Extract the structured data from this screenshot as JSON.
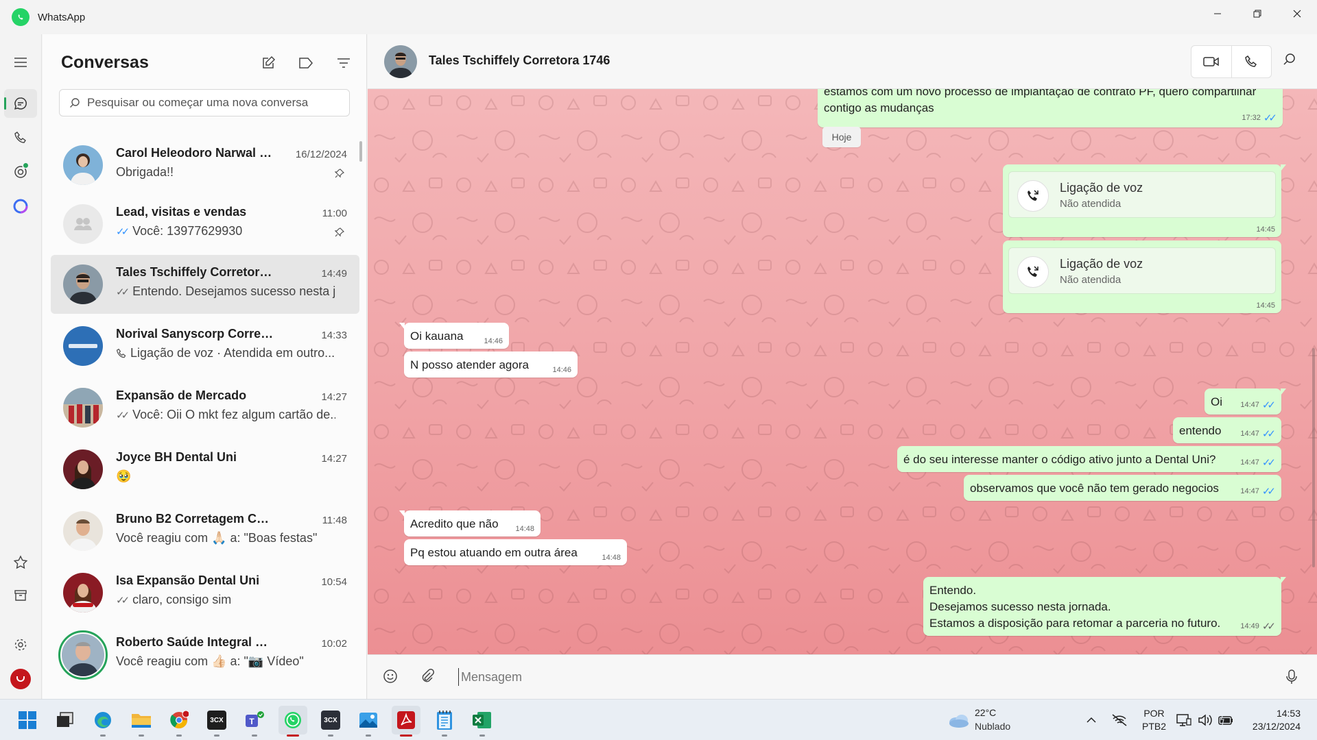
{
  "window": {
    "title": "WhatsApp"
  },
  "colors": {
    "accent": "#25a35a",
    "outgoing_bubble": "#d9fdd3",
    "chat_wallpaper": "#f0a3a6",
    "read_ticks": "#3493ff"
  },
  "sidebar": {
    "title": "Conversas",
    "search_placeholder": "Pesquisar ou começar uma nova conversa",
    "conversations": [
      {
        "name": "Carol Heleodoro Narwal Le...",
        "time": "16/12/2024",
        "preview": "Obrigada!!",
        "pinned": true,
        "ticks": ""
      },
      {
        "name": "Lead, visitas e vendas",
        "time": "11:00",
        "preview": "Você: 13977629930",
        "pinned": true,
        "ticks": "read"
      },
      {
        "name": "Tales Tschiffely Corretora 1746",
        "time": "14:49",
        "preview": "Entendo. Desejamos sucesso nesta j...",
        "pinned": false,
        "ticks": "delivered"
      },
      {
        "name": "Norival Sanyscorp Corretora 1773",
        "time": "14:33",
        "preview": "Ligação de voz · Atendida em outro...",
        "pinned": false,
        "ticks": ""
      },
      {
        "name": "Expansão de Mercado",
        "time": "14:27",
        "preview": "Você: Oii O mkt fez algum cartão de...",
        "pinned": false,
        "ticks": "delivered"
      },
      {
        "name": "Joyce BH Dental Uni",
        "time": "14:27",
        "preview": "🥹",
        "pinned": false,
        "ticks": ""
      },
      {
        "name": "Bruno B2 Corretagem Corretora...",
        "time": "11:48",
        "preview": "Você reagiu com 🙏🏻 a: \"Boas festas\"",
        "pinned": false,
        "ticks": ""
      },
      {
        "name": "Isa Expansão Dental Uni",
        "time": "10:54",
        "preview": "claro, consigo sim",
        "pinned": false,
        "ticks": "delivered"
      },
      {
        "name": "Roberto Saúde Integral Corretor...",
        "time": "10:02",
        "preview": "Você reagiu com 👍🏻 a: \"📷 Vídeo\"",
        "pinned": false,
        "ticks": ""
      }
    ]
  },
  "chat": {
    "contact_name": "Tales Tschiffely Corretora 1746",
    "day_chip": "Hoje",
    "composer_placeholder": "Mensagem",
    "messages": {
      "m0_line1": "estamos com um novo processo de implantação de contrato PF, quero compartilhar",
      "m0_line2": "contigo as mudanças",
      "m0_time": "17:32",
      "call1_title": "Ligação de voz",
      "call1_sub": "Não atendida",
      "call1_time": "14:45",
      "call2_title": "Ligação de voz",
      "call2_sub": "Não atendida",
      "call2_time": "14:45",
      "in1": "Oi kauana",
      "in1_time": "14:46",
      "in2": "N posso atender agora",
      "in2_time": "14:46",
      "out1": "Oi",
      "out1_time": "14:47",
      "out2": "entendo",
      "out2_time": "14:47",
      "out3": "é do seu interesse manter o código ativo junto a Dental Uni?",
      "out3_time": "14:47",
      "out4": "observamos que você não tem gerado negocios",
      "out4_time": "14:47",
      "in3": "Acredito que não",
      "in3_time": "14:48",
      "in4": "Pq estou atuando em outra área",
      "in4_time": "14:48",
      "last_line1": "Entendo.",
      "last_line2": "Desejamos sucesso nesta jornada.",
      "last_line3": "Estamos a disposição para retomar a parceria no futuro.",
      "last_time": "14:49"
    }
  },
  "taskbar": {
    "apps": [
      "start",
      "task-view",
      "edge",
      "file-explorer",
      "chrome",
      "3cx",
      "teams",
      "whatsapp",
      "3cx",
      "photos",
      "acrobat",
      "notepad",
      "excel"
    ],
    "tile_3cx": "3CX",
    "weather_temp": "22°C",
    "weather_desc": "Nublado",
    "lang_1": "POR",
    "lang_2": "PTB2",
    "time": "14:53",
    "date": "23/12/2024"
  }
}
